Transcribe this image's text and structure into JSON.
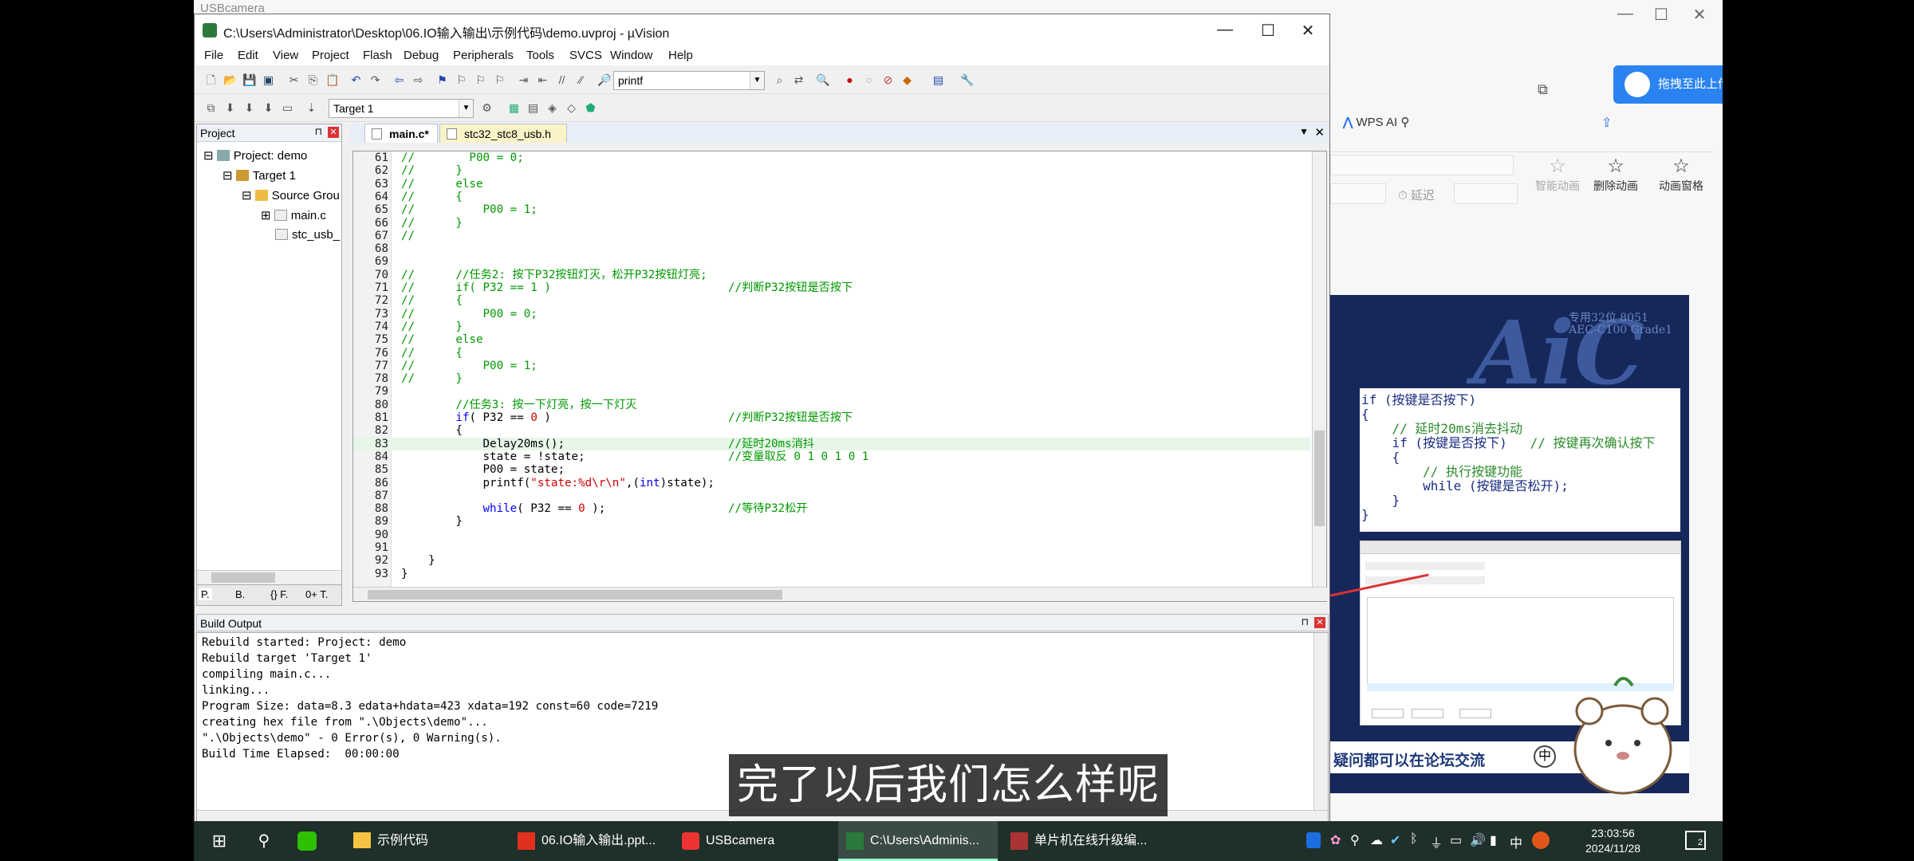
{
  "background_window": {
    "title": "USBcamera",
    "upload_button": "拖拽至此上传",
    "wps_ai": "WPS AI",
    "ribbon_delay_label": "延迟",
    "ribbon_items": [
      "智能动画",
      "删除动画",
      "动画窗格"
    ]
  },
  "slide": {
    "logo": "AiC",
    "tagline": "专用32位 8051\nAEC-C100 Grade1",
    "code_lines": [
      {
        "text": "if (按键是否按下)",
        "comment": false
      },
      {
        "text": "{",
        "comment": false
      },
      {
        "text": "    // 延时20ms消去抖动",
        "comment": true
      },
      {
        "text": "    if (按键是否按下)   ",
        "comment": false,
        "tail": "// 按键再次确认按下"
      },
      {
        "text": "    {",
        "comment": false
      },
      {
        "text": "        // 执行按键功能",
        "comment": true
      },
      {
        "text": "        while (按键是否松开);",
        "comment": false
      },
      {
        "text": "    }",
        "comment": false
      },
      {
        "text": "}",
        "comment": false
      }
    ],
    "forum_text": "疑问都可以在论坛交流"
  },
  "uvision": {
    "title": "C:\\Users\\Administrator\\Desktop\\06.IO输入输出\\示例代码\\demo.uvproj - µVision",
    "menu": [
      "File",
      "Edit",
      "View",
      "Project",
      "Flash",
      "Debug",
      "Peripherals",
      "Tools",
      "SVCS",
      "Window",
      "Help"
    ],
    "find_combo": "printf",
    "target_combo": "Target 1",
    "project_panel": {
      "title": "Project",
      "items": [
        "Project: demo",
        "Target 1",
        "Source Grou",
        "main.c",
        "stc_usb_"
      ],
      "tabs": [
        "P.",
        "B.",
        "{} F.",
        "0+ T."
      ]
    },
    "editor_tabs": [
      "main.c*",
      "stc32_stc8_usb.h"
    ],
    "code": [
      {
        "n": "61",
        "t": "//        P00 = 0;"
      },
      {
        "n": "62",
        "t": "//      }"
      },
      {
        "n": "63",
        "t": "//      else"
      },
      {
        "n": "64",
        "t": "//      {"
      },
      {
        "n": "65",
        "t": "//          P00 = 1;"
      },
      {
        "n": "66",
        "t": "//      }"
      },
      {
        "n": "67",
        "t": "//"
      },
      {
        "n": "68",
        "t": ""
      },
      {
        "n": "69",
        "t": ""
      },
      {
        "n": "70",
        "t": "//      //任务2: 按下P32按钮灯灭，松开P32按钮灯亮;"
      },
      {
        "n": "71",
        "t": "//      if( P32 == 1 )                          //判断P32按钮是否按下"
      },
      {
        "n": "72",
        "t": "//      {"
      },
      {
        "n": "73",
        "t": "//          P00 = 0;"
      },
      {
        "n": "74",
        "t": "//      }"
      },
      {
        "n": "75",
        "t": "//      else"
      },
      {
        "n": "76",
        "t": "//      {"
      },
      {
        "n": "77",
        "t": "//          P00 = 1;"
      },
      {
        "n": "78",
        "t": "//      }"
      },
      {
        "n": "79",
        "t": ""
      },
      {
        "n": "80",
        "t": "        //任务3: 按一下灯亮，按一下灯灭"
      },
      {
        "n": "81",
        "t": "        if( P32 == 0 )                          //判断P32按钮是否按下"
      },
      {
        "n": "82",
        "t": "        {"
      },
      {
        "n": "83",
        "t": "            Delay20ms();                        //延时20ms消抖"
      },
      {
        "n": "84",
        "t": "            state = !state;                     //变量取反 0 1 0 1 0 1"
      },
      {
        "n": "85",
        "t": "            P00 = state;"
      },
      {
        "n": "86",
        "t": "            printf(\"state:%d\\r\\n\",(int)state);"
      },
      {
        "n": "87",
        "t": ""
      },
      {
        "n": "88",
        "t": "            while( P32 == 0 );                  //等待P32松开"
      },
      {
        "n": "89",
        "t": "        }"
      },
      {
        "n": "90",
        "t": ""
      },
      {
        "n": "91",
        "t": ""
      },
      {
        "n": "92",
        "t": "    }"
      },
      {
        "n": "93",
        "t": "}"
      }
    ],
    "build_output": {
      "title": "Build Output",
      "lines": [
        "Rebuild started: Project: demo",
        "Rebuild target 'Target 1'",
        "compiling main.c...",
        "linking...",
        "Program Size: data=8.3 edata+hdata=423 xdata=192 const=60 code=7219",
        "creating hex file from \".\\Objects\\demo\"...",
        "\".\\Objects\\demo\" - 0 Error(s), 0 Warning(s).",
        "Build Time Elapsed:  00:00:00"
      ]
    }
  },
  "subtitle": "完了以后我们怎么样呢",
  "taskbar": {
    "tasks": [
      "示例代码",
      "06.IO输入输出.ppt...",
      "USBcamera",
      "C:\\Users\\Adminis...",
      "单片机在线升级编..."
    ],
    "ime": "中",
    "time": "23:03:56",
    "date": "2024/11/28",
    "notifications": "2"
  }
}
